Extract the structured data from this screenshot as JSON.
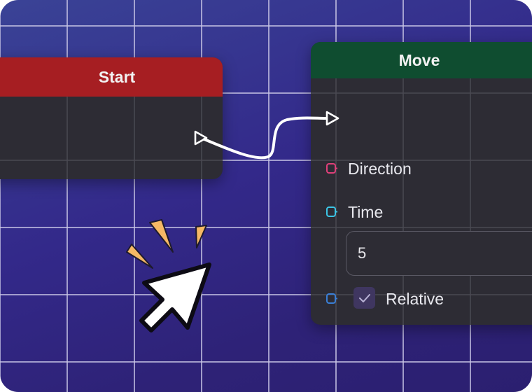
{
  "nodes": {
    "start": {
      "title": "Start",
      "header_color": "#a61e22"
    },
    "move": {
      "title": "Move",
      "header_color": "#0f4d30",
      "inputs": {
        "direction": {
          "label": "Direction",
          "pin_color": "#e0407a"
        },
        "time": {
          "label": "Time",
          "pin_color": "#3cc6e6",
          "value": "5"
        },
        "relative": {
          "label": "Relative",
          "pin_color": "#3a7fd6",
          "checked": true
        }
      }
    }
  },
  "connection": {
    "from": "Start",
    "to": "Move",
    "color": "#ffffff"
  },
  "cursor": {
    "icon": "pointer-cursor-icon",
    "burst_color": "#f5b865"
  },
  "colors": {
    "background_start": "#3a4396",
    "background_end": "#2b1f70",
    "node_body": "#2d2c34",
    "grid_line": "#c9c6e6"
  }
}
